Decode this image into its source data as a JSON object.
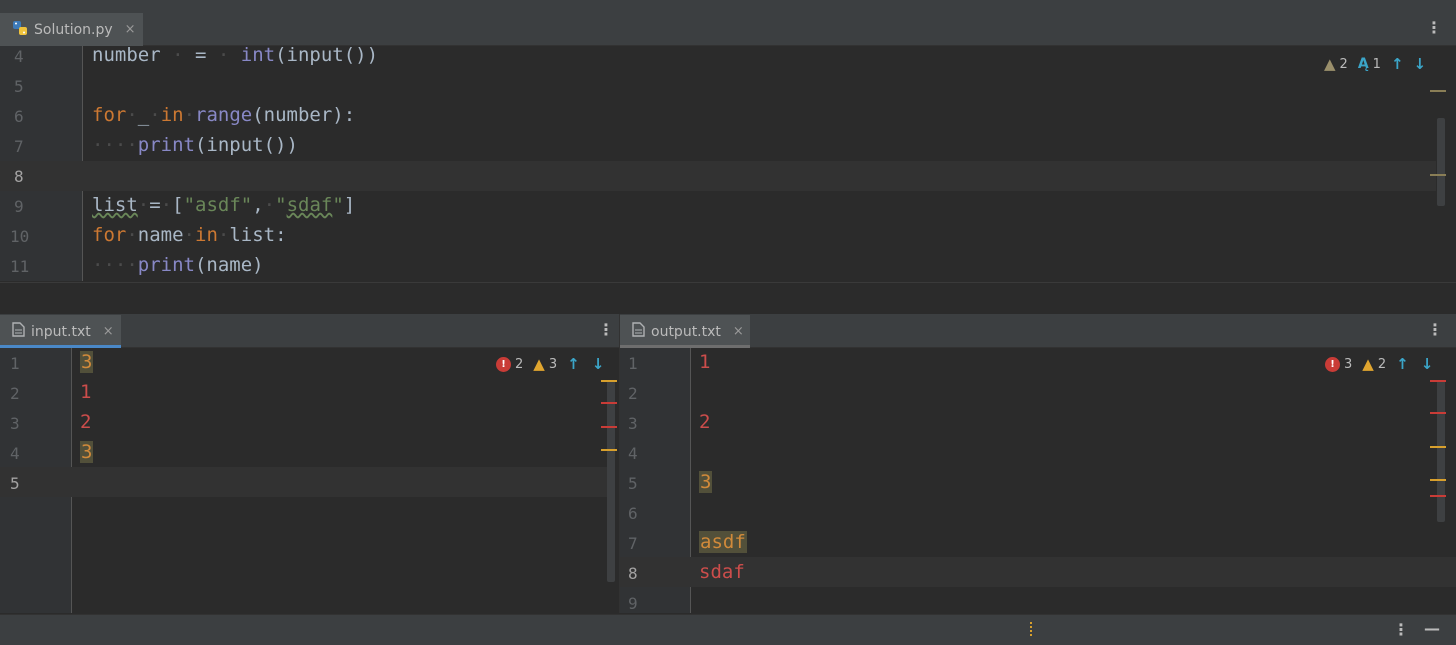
{
  "editor": {
    "tab": {
      "label": "Solution.py",
      "close": "×"
    },
    "menu": "⋮",
    "inspections": {
      "warnings": "2",
      "typos": "1"
    },
    "lines": [
      "4",
      "5",
      "6",
      "7",
      "8",
      "9",
      "10",
      "11"
    ],
    "current_line": "8",
    "code": [
      [
        [
          "",
          "number"
        ],
        [
          "dot",
          " · "
        ],
        [
          "",
          "="
        ],
        [
          "dot",
          " · "
        ],
        [
          "bi",
          "int"
        ],
        [
          "",
          "(input())"
        ]
      ],
      [],
      [
        [
          "kw",
          "for"
        ],
        [
          "dot",
          "·"
        ],
        [
          "",
          "_"
        ],
        [
          "dot",
          "·"
        ],
        [
          "kw",
          "in"
        ],
        [
          "dot",
          "·"
        ],
        [
          "bi",
          "range"
        ],
        [
          "",
          "(number):"
        ]
      ],
      [
        [
          "dot",
          "····"
        ],
        [
          "bi",
          "print"
        ],
        [
          "",
          "(input())"
        ]
      ],
      [],
      [
        [
          "warnw",
          "list"
        ],
        [
          "dot",
          "·"
        ],
        [
          "",
          "="
        ],
        [
          "dot",
          "·"
        ],
        [
          "",
          "["
        ],
        [
          "st",
          "\"asdf\""
        ],
        [
          "",
          ","
        ],
        [
          "dot",
          "·"
        ],
        [
          "st",
          "\""
        ],
        [
          "stw",
          "sdaf"
        ],
        [
          "st",
          "\""
        ],
        [
          "",
          "]"
        ]
      ],
      [
        [
          "kw",
          "for"
        ],
        [
          "dot",
          "·"
        ],
        [
          "",
          "name"
        ],
        [
          "dot",
          "·"
        ],
        [
          "kw",
          "in"
        ],
        [
          "dot",
          "·"
        ],
        [
          "",
          "list:"
        ]
      ],
      [
        [
          "dot",
          "····"
        ],
        [
          "bi",
          "print"
        ],
        [
          "",
          "(name)"
        ]
      ]
    ]
  },
  "input_pane": {
    "tab": {
      "label": "input.txt",
      "close": "×"
    },
    "menu": "⋮",
    "inspections": {
      "errors": "2",
      "warnings": "3"
    },
    "lines": [
      "1",
      "2",
      "3",
      "4",
      "5"
    ],
    "current_line": "5",
    "content": [
      {
        "text": "3",
        "kind": "warn"
      },
      {
        "text": "1",
        "kind": "error"
      },
      {
        "text": "2",
        "kind": "error"
      },
      {
        "text": "3",
        "kind": "warn"
      }
    ]
  },
  "output_pane": {
    "tab": {
      "label": "output.txt",
      "close": "×"
    },
    "menu": "⋮",
    "inspections": {
      "errors": "3",
      "warnings": "2"
    },
    "lines": [
      "1",
      "2",
      "3",
      "4",
      "5",
      "6",
      "7",
      "8",
      "9"
    ],
    "current_line": "8",
    "content": [
      {
        "line": "1",
        "text": "1",
        "kind": "error"
      },
      {
        "line": "3",
        "text": "2",
        "kind": "error"
      },
      {
        "line": "5",
        "text": "3",
        "kind": "warn"
      },
      {
        "line": "7",
        "text": "asdf",
        "kind": "warn"
      },
      {
        "line": "8",
        "text": "sdaf",
        "kind": "error"
      }
    ]
  },
  "colors": {
    "error": "#cc4d4b",
    "warn": "#d18a3a",
    "accent": "#4a88c7",
    "background": "#2b2b2b"
  },
  "statusbar": {
    "menu": "⋮",
    "minimize": "—"
  }
}
